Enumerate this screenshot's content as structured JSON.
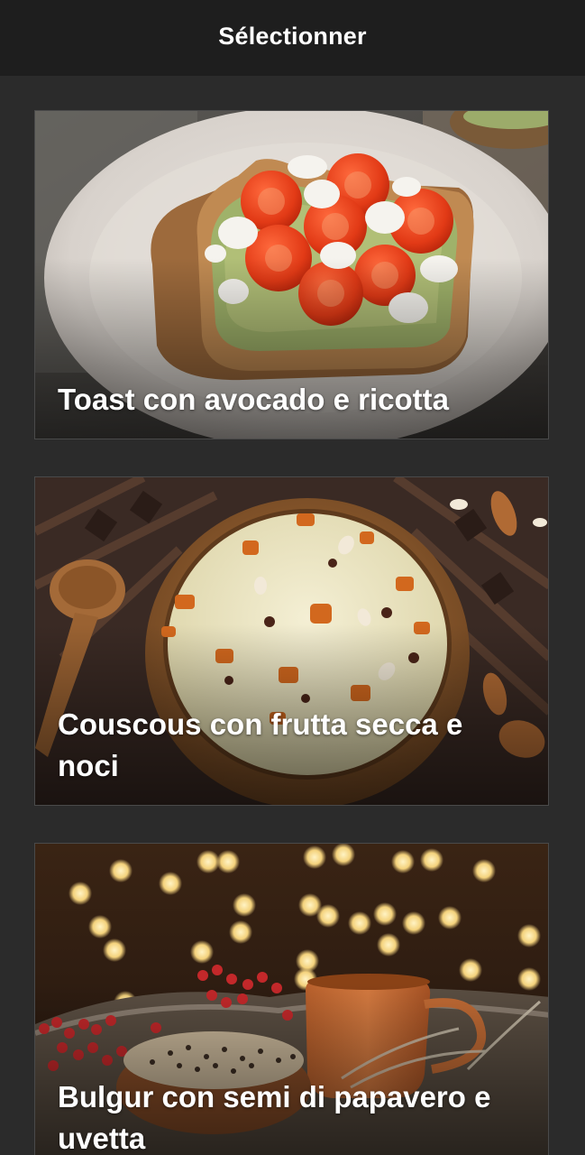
{
  "header": {
    "title": "Sélectionner"
  },
  "recipes": [
    {
      "title": "Toast con avocado e ricotta"
    },
    {
      "title": "Couscous con frutta secca e noci"
    },
    {
      "title": "Bulgur con semi di papavero e uvetta"
    }
  ]
}
